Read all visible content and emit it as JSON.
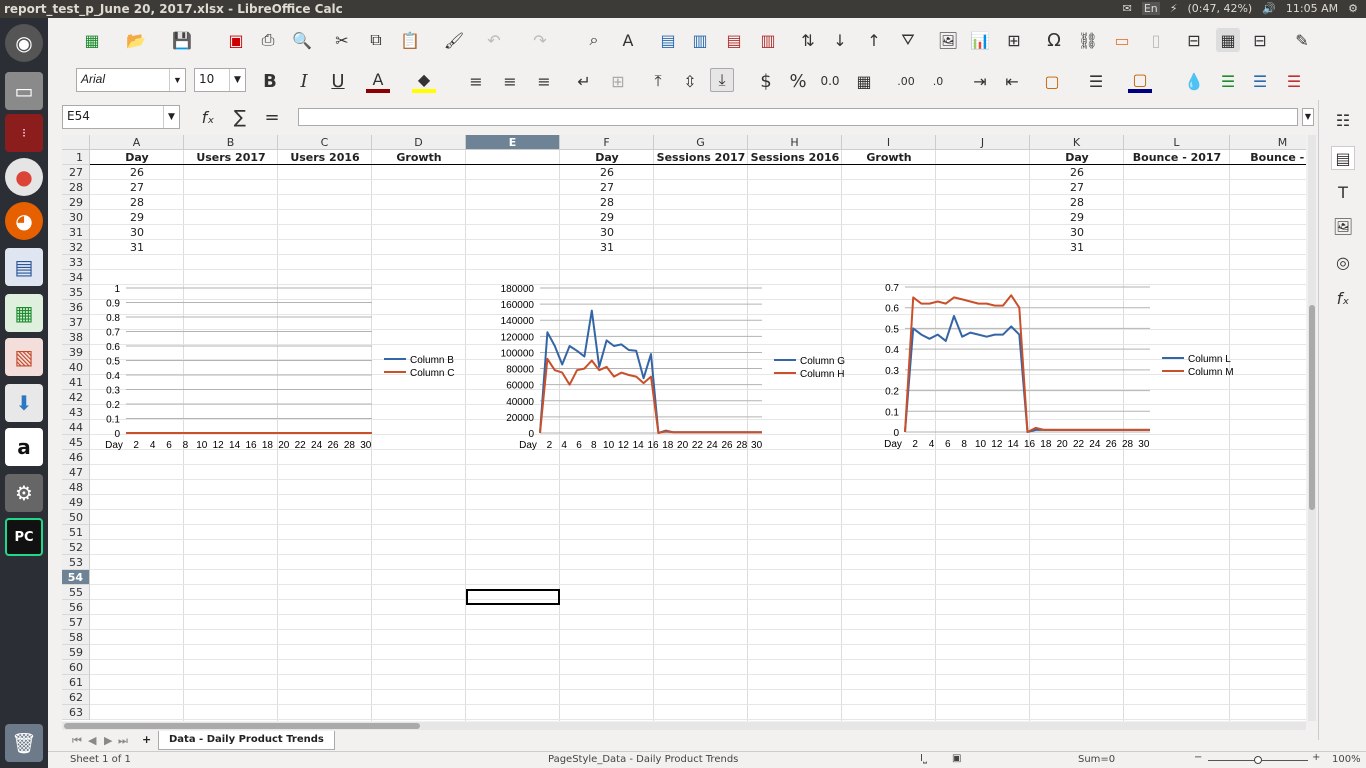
{
  "window": {
    "title": "report_test_p_June 20, 2017.xlsx - LibreOffice Calc"
  },
  "tray": {
    "keyboard": "En",
    "battery": "(0:47, 42%)",
    "time": "11:05 AM"
  },
  "format": {
    "font_name": "Arial",
    "font_size": "10"
  },
  "formula": {
    "name_box": "E54",
    "content": ""
  },
  "columns": [
    "A",
    "B",
    "C",
    "D",
    "E",
    "F",
    "G",
    "H",
    "I",
    "J",
    "K",
    "L",
    "M"
  ],
  "headers": {
    "A": "Day",
    "B": "Users 2017",
    "C": "Users 2016",
    "D": "Growth",
    "E": "",
    "F": "Day",
    "G": "Sessions 2017",
    "H": "Sessions 2016",
    "I": "Growth",
    "J": "",
    "K": "Day",
    "L": "Bounce - 2017",
    "M": "Bounce - 2"
  },
  "rows": [
    "1",
    "27",
    "28",
    "29",
    "30",
    "31",
    "32",
    "33",
    "34",
    "35",
    "36",
    "37",
    "38",
    "39",
    "40",
    "41",
    "42",
    "43",
    "44",
    "45",
    "46",
    "47",
    "48",
    "49",
    "50",
    "51",
    "52",
    "53",
    "54",
    "55",
    "56",
    "57",
    "58",
    "59",
    "60",
    "61",
    "62",
    "63"
  ],
  "day_values": [
    "26",
    "27",
    "28",
    "29",
    "30",
    "31"
  ],
  "selected_row": "54",
  "chart_data": [
    {
      "type": "line",
      "y_ticks": [
        "1",
        "0.9",
        "0.8",
        "0.7",
        "0.6",
        "0.5",
        "0.4",
        "0.3",
        "0.2",
        "0.1",
        "0"
      ],
      "ylim": [
        0,
        1
      ],
      "x_ticks": [
        "Day",
        "2",
        "4",
        "6",
        "8",
        "10",
        "12",
        "14",
        "16",
        "18",
        "20",
        "22",
        "24",
        "26",
        "28",
        "30"
      ],
      "series": [
        {
          "name": "Column B",
          "color": "#3465a4",
          "values": [
            0,
            0,
            0,
            0,
            0,
            0,
            0,
            0,
            0,
            0,
            0,
            0,
            0,
            0,
            0,
            0,
            0,
            0,
            0,
            0,
            0,
            0,
            0,
            0,
            0,
            0,
            0,
            0,
            0,
            0,
            0
          ]
        },
        {
          "name": "Column C",
          "color": "#c9502a",
          "values": [
            0,
            0,
            0,
            0,
            0,
            0,
            0,
            0,
            0,
            0,
            0,
            0,
            0,
            0,
            0,
            0,
            0,
            0,
            0,
            0,
            0,
            0,
            0,
            0,
            0,
            0,
            0,
            0,
            0,
            0,
            0
          ]
        }
      ]
    },
    {
      "type": "line",
      "y_ticks": [
        "180000",
        "160000",
        "140000",
        "120000",
        "100000",
        "80000",
        "60000",
        "40000",
        "20000",
        "0"
      ],
      "ylim": [
        0,
        180000
      ],
      "x_ticks": [
        "Day",
        "2",
        "4",
        "6",
        "8",
        "10",
        "12",
        "14",
        "16",
        "18",
        "20",
        "22",
        "24",
        "26",
        "28",
        "30"
      ],
      "series": [
        {
          "name": "Column G",
          "color": "#3465a4",
          "values": [
            0,
            125000,
            108000,
            85000,
            108000,
            102000,
            95000,
            152000,
            82000,
            115000,
            108000,
            110000,
            103000,
            102000,
            68000,
            98000,
            0,
            3000,
            1000,
            1000,
            1000,
            1000,
            1000,
            1000,
            1000,
            1000,
            1000,
            1000,
            1000,
            1000,
            1000
          ]
        },
        {
          "name": "Column H",
          "color": "#c9502a",
          "values": [
            0,
            92000,
            78000,
            75000,
            60000,
            78000,
            80000,
            90000,
            78000,
            82000,
            70000,
            75000,
            72000,
            70000,
            62000,
            70000,
            0,
            2000,
            1000,
            1000,
            1000,
            1000,
            1000,
            1000,
            1000,
            1000,
            1000,
            1000,
            1000,
            1000,
            1000
          ]
        }
      ]
    },
    {
      "type": "line",
      "y_ticks": [
        "0.7",
        "0.6",
        "0.5",
        "0.4",
        "0.3",
        "0.2",
        "0.1",
        "0"
      ],
      "ylim": [
        0,
        0.7
      ],
      "x_ticks": [
        "Day",
        "2",
        "4",
        "6",
        "8",
        "10",
        "12",
        "14",
        "16",
        "18",
        "20",
        "22",
        "24",
        "26",
        "28",
        "30"
      ],
      "series": [
        {
          "name": "Column L",
          "color": "#3465a4",
          "values": [
            0,
            0.5,
            0.47,
            0.45,
            0.47,
            0.44,
            0.56,
            0.46,
            0.48,
            0.47,
            0.46,
            0.47,
            0.47,
            0.51,
            0.47,
            0.0,
            0.01,
            0.01,
            0.01,
            0.01,
            0.01,
            0.01,
            0.01,
            0.01,
            0.01,
            0.01,
            0.01,
            0.01,
            0.01,
            0.01,
            0.01
          ]
        },
        {
          "name": "Column M",
          "color": "#c9502a",
          "values": [
            0,
            0.65,
            0.62,
            0.62,
            0.63,
            0.62,
            0.65,
            0.64,
            0.63,
            0.62,
            0.62,
            0.61,
            0.61,
            0.66,
            0.6,
            0.0,
            0.02,
            0.01,
            0.01,
            0.01,
            0.01,
            0.01,
            0.01,
            0.01,
            0.01,
            0.01,
            0.01,
            0.01,
            0.01,
            0.01,
            0.01
          ]
        }
      ]
    }
  ],
  "sheet_tab": "Data - Daily Product Trends",
  "status": {
    "sheet": "Sheet 1 of 1",
    "page_style": "PageStyle_Data - Daily Product Trends",
    "sum": "Sum=0",
    "zoom": "100%"
  }
}
